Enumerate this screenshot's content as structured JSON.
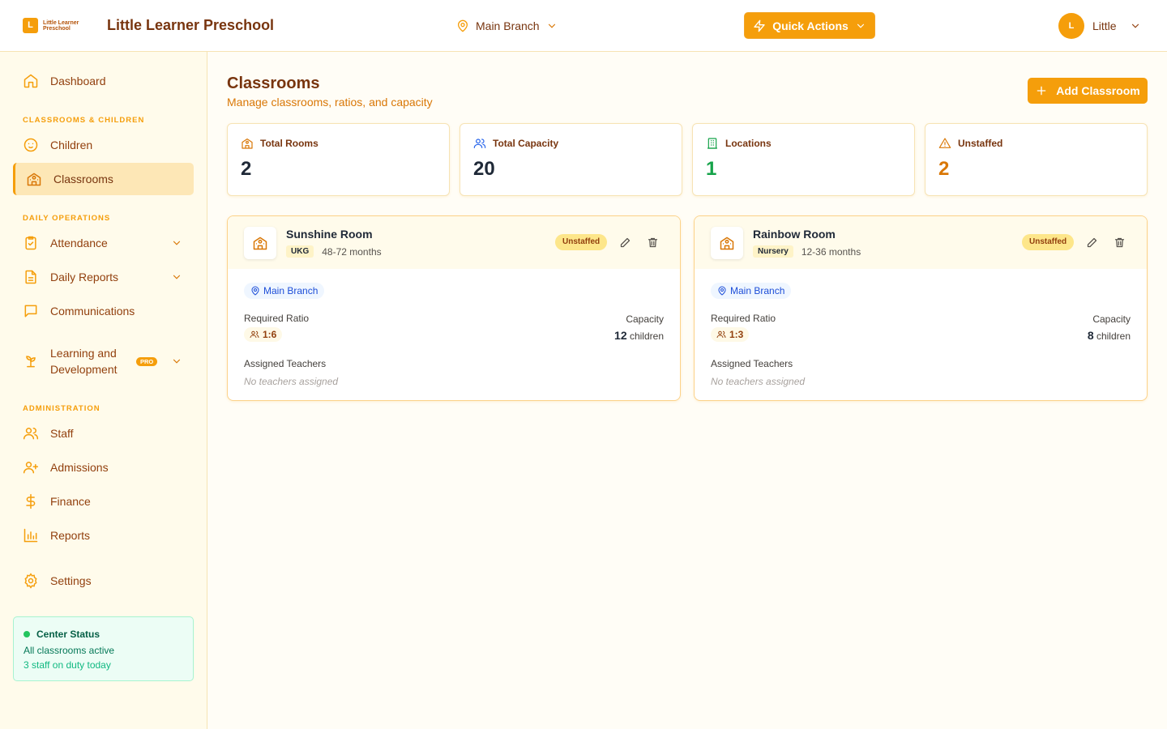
{
  "header": {
    "logo_letter": "L",
    "logo_text": "Little Learner Preschool",
    "app_title": "Little Learner Preschool",
    "branch": "Main Branch",
    "quick_actions": "Quick Actions",
    "avatar_initial": "L",
    "user_name": "Little"
  },
  "sidebar": {
    "dashboard": "Dashboard",
    "section_classrooms": "CLASSROOMS & CHILDREN",
    "children": "Children",
    "classrooms": "Classrooms",
    "section_daily": "DAILY OPERATIONS",
    "attendance": "Attendance",
    "daily_reports": "Daily Reports",
    "communications": "Communications",
    "learning_line1": "Learning and",
    "learning_line2": "Development",
    "pro": "PRO",
    "section_admin": "ADMINISTRATION",
    "staff": "Staff",
    "admissions": "Admissions",
    "finance": "Finance",
    "reports": "Reports",
    "settings": "Settings",
    "status": {
      "title": "Center Status",
      "line1": "All classrooms active",
      "line2": "3 staff on duty today"
    }
  },
  "main": {
    "title": "Classrooms",
    "subtitle": "Manage classrooms, ratios, and capacity",
    "add_button": "Add Classroom",
    "stats": [
      {
        "label": "Total Rooms",
        "value": "2",
        "color": "#1f2937"
      },
      {
        "label": "Total Capacity",
        "value": "20",
        "color": "#1f2937"
      },
      {
        "label": "Locations",
        "value": "1",
        "color": "#16a34a"
      },
      {
        "label": "Unstaffed",
        "value": "2",
        "color": "#d97706"
      }
    ],
    "rooms": [
      {
        "name": "Sunshine Room",
        "grade": "UKG",
        "age_range": "48-72 months",
        "status": "Unstaffed",
        "location": "Main Branch",
        "ratio_label": "Required Ratio",
        "ratio": "1:6",
        "capacity_label": "Capacity",
        "capacity": "12",
        "capacity_unit": "children",
        "teachers_label": "Assigned Teachers",
        "teachers": "No teachers assigned"
      },
      {
        "name": "Rainbow Room",
        "grade": "Nursery",
        "age_range": "12-36 months",
        "status": "Unstaffed",
        "location": "Main Branch",
        "ratio_label": "Required Ratio",
        "ratio": "1:3",
        "capacity_label": "Capacity",
        "capacity": "8",
        "capacity_unit": "children",
        "teachers_label": "Assigned Teachers",
        "teachers": "No teachers assigned"
      }
    ]
  },
  "colors": {
    "accent": "#f59e0b",
    "brand_dark": "#78350f",
    "success": "#16a34a",
    "warning": "#d97706"
  }
}
